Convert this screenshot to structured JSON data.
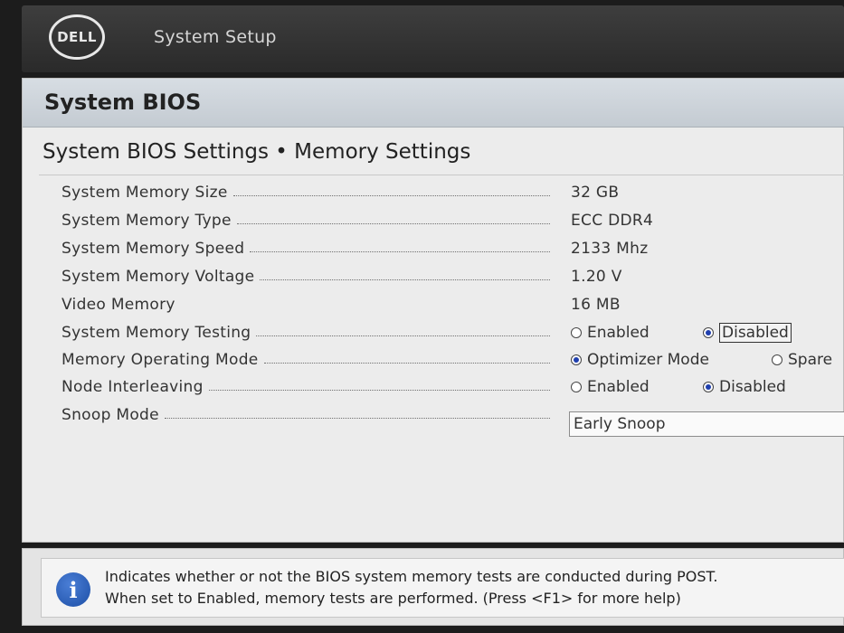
{
  "header": {
    "logo": "DELL",
    "app_title": "System Setup"
  },
  "page": {
    "title": "System BIOS",
    "section_title": "System BIOS Settings • Memory Settings"
  },
  "settings": [
    {
      "label": "System Memory Size",
      "value": "32 GB"
    },
    {
      "label": "System Memory Type",
      "value": "ECC DDR4"
    },
    {
      "label": "System Memory Speed",
      "value": "2133 Mhz"
    },
    {
      "label": "System Memory Voltage",
      "value": "1.20 V"
    },
    {
      "label": "Video Memory",
      "value": "16 MB"
    },
    {
      "label": "System Memory Testing",
      "options": [
        "Enabled",
        "Disabled"
      ],
      "selected": "Disabled"
    },
    {
      "label": "Memory Operating Mode",
      "options": [
        "Optimizer Mode",
        "Spare"
      ],
      "selected": "Optimizer Mode"
    },
    {
      "label": "Node Interleaving",
      "options": [
        "Enabled",
        "Disabled"
      ],
      "selected": "Disabled"
    },
    {
      "label": "Snoop Mode",
      "value": "Early Snoop"
    }
  ],
  "help": {
    "icon": "info-icon",
    "line1": "Indicates whether or not the BIOS system memory tests are conducted during POST.",
    "line2": "When set to Enabled, memory tests are performed. (Press <F1> for more help)"
  },
  "colors": {
    "header_bg": "#2f2f2f",
    "panel_bg": "#ececec",
    "radio_selected": "#1f3fae",
    "info_icon": "#1d4fa6"
  }
}
